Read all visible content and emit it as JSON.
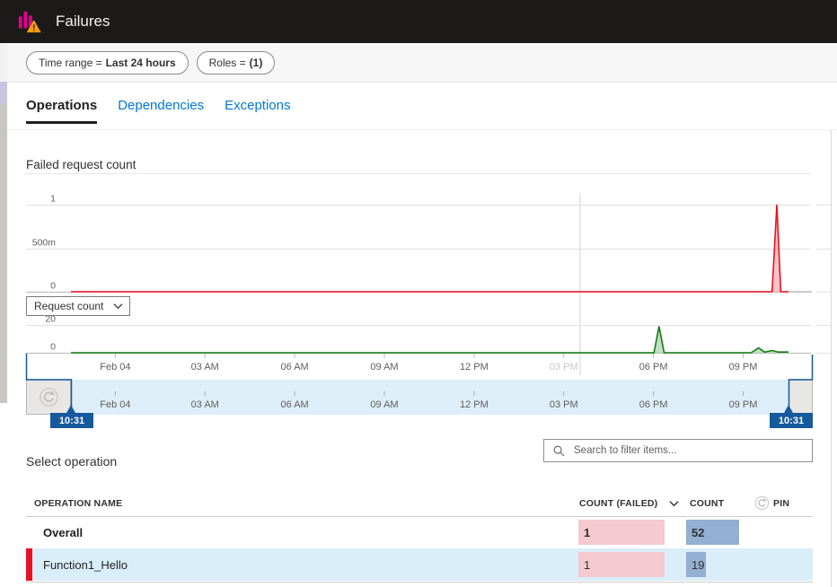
{
  "header": {
    "title": "Failures",
    "icon": "bar-chart-warning-icon"
  },
  "filters": [
    {
      "label": "Time range = ",
      "value": "Last 24 hours"
    },
    {
      "label": "Roles = ",
      "value": "(1)"
    }
  ],
  "tabs": [
    {
      "label": "Operations",
      "active": true
    },
    {
      "label": "Dependencies",
      "active": false
    },
    {
      "label": "Exceptions",
      "active": false
    }
  ],
  "sections": {
    "failed_chart_title": "Failed request count",
    "select_operation": "Select operation"
  },
  "metric_dropdown": {
    "value": "Request count"
  },
  "search": {
    "placeholder": "Search to filter items..."
  },
  "brush": {
    "start_label": "10:31",
    "end_label": "10:31"
  },
  "xaxis": {
    "labels": [
      "Feb 04",
      "03 AM",
      "06 AM",
      "09 AM",
      "12 PM",
      "03 PM",
      "06 PM",
      "09 PM"
    ],
    "t_hours": [
      1.483,
      4.483,
      7.483,
      10.483,
      13.483,
      16.483,
      19.483,
      22.483
    ],
    "faded_index": 5,
    "cursor_t": 17.03,
    "range_hours": 24
  },
  "chart_data": [
    {
      "type": "line",
      "title": "Failed request count",
      "color": "#e81123",
      "ylim": [
        0,
        1
      ],
      "yticks": [
        {
          "value": 1,
          "label": "1"
        },
        {
          "value": 0.5,
          "label": "500m"
        },
        {
          "value": 0,
          "label": "0"
        }
      ],
      "series": [
        {
          "name": "Failed request count",
          "points": [
            [
              0,
              0
            ],
            [
              23.45,
              0
            ],
            [
              23.61,
              1
            ],
            [
              23.74,
              0
            ],
            [
              24,
              0
            ]
          ]
        }
      ],
      "no_data_tail_t": 24.78
    },
    {
      "type": "line",
      "title": "Request count",
      "color": "#107c10",
      "ylim": [
        0,
        20
      ],
      "yticks": [
        {
          "value": 20,
          "label": "20"
        },
        {
          "value": 0,
          "label": "0"
        }
      ],
      "series": [
        {
          "name": "Request count",
          "points": [
            [
              0,
              0
            ],
            [
              19.5,
              0
            ],
            [
              19.67,
              19
            ],
            [
              19.84,
              0
            ],
            [
              22.75,
              0
            ],
            [
              23.0,
              3.5
            ],
            [
              23.2,
              0.5
            ],
            [
              23.45,
              1.6
            ],
            [
              23.65,
              0.5
            ],
            [
              24,
              0.5
            ]
          ]
        }
      ]
    }
  ],
  "table": {
    "columns": [
      "OPERATION NAME",
      "COUNT (FAILED)",
      "COUNT",
      "PIN"
    ],
    "rows": [
      {
        "name": "Overall",
        "count_failed": 1,
        "count": 52,
        "bold": true,
        "selected": false
      },
      {
        "name": "Function1_Hello",
        "count_failed": 1,
        "count": 19,
        "bold": false,
        "selected": true
      }
    ]
  },
  "colors": {
    "header_bg": "#1b1a19",
    "accent_blue": "#0078d4",
    "brush_blue": "#155a9c",
    "fail_red": "#e81123",
    "request_green": "#107c10",
    "pink_bar": "#f4c9cf",
    "blue_bar": "#93afd2",
    "selected_row_bg": "#daeef9",
    "brush_strip_bg": "#ddeef8",
    "icon_magenta": "#e3008c",
    "warning_orange": "#fa9e0d"
  }
}
